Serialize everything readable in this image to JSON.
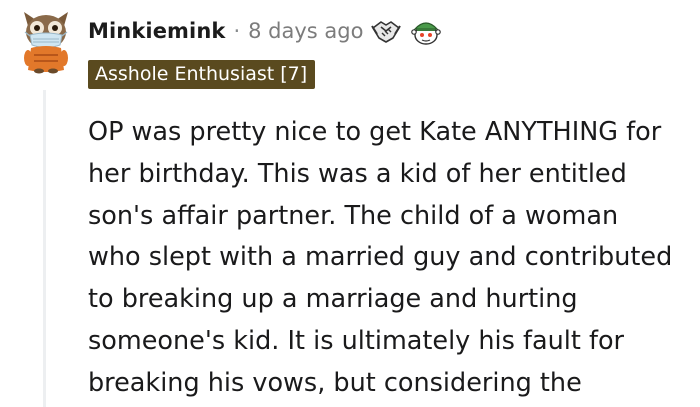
{
  "comment": {
    "username": "Minkiemink",
    "separator": "·",
    "timestamp": "8 days ago",
    "flair": "Asshole Enthusiast [7]",
    "body_lines": [
      "OP was pretty nice to get Kate ANYTHING for",
      "her birthday. This was a kid of her entitled",
      "son's affair partner. The child of a woman",
      "who slept with a married guy and contributed",
      "to breaking up a marriage and hurting",
      "someone's kid. It is ultimately his fault for",
      "breaking his vows, but considering the"
    ],
    "awards": [
      "handshake-award-icon",
      "gamer-snoo-award-icon"
    ]
  },
  "colors": {
    "username": "#1c1c1c",
    "timestamp": "#7c7c7c",
    "flair_bg": "#5a4a1f",
    "flair_text": "#ffffff",
    "body_text": "#1a1a1b",
    "thread_line": "#edeff1"
  }
}
